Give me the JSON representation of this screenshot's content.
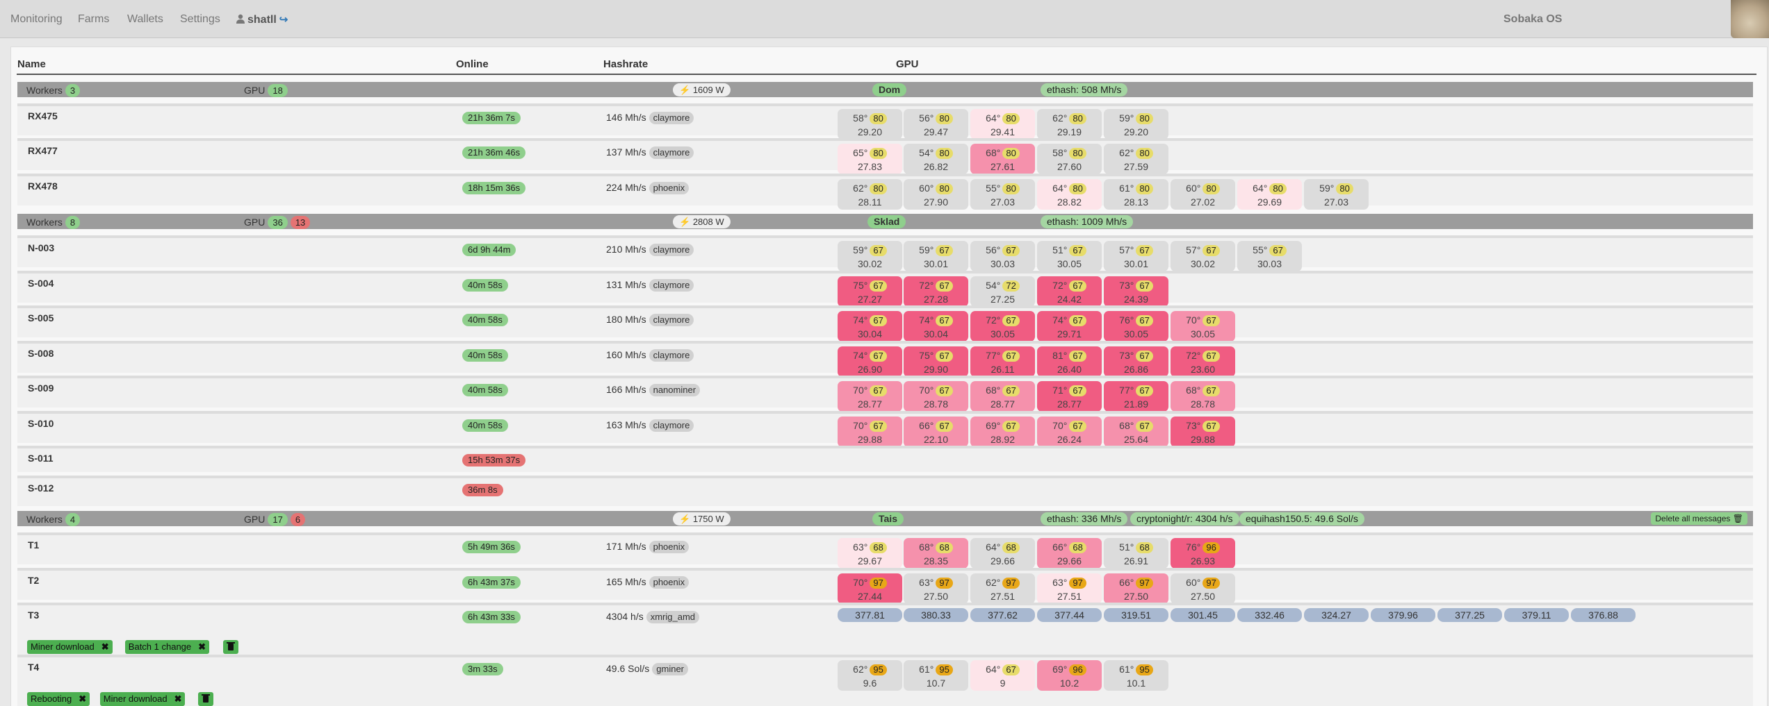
{
  "nav": {
    "items": [
      "Monitoring",
      "Farms",
      "Wallets",
      "Settings"
    ],
    "user": "shatll",
    "brand": "Sobaka OS"
  },
  "headers": {
    "name": "Name",
    "online": "Online",
    "hashrate": "Hashrate",
    "gpu": "GPU"
  },
  "farms": [
    {
      "workers_label": "Workers",
      "workers_count": "3",
      "gpu_label": "GPU",
      "gpu_ok": "18",
      "gpu_bad": "",
      "power": "1609 W",
      "name": "Dom",
      "algos": [
        "ethash: 508 Mh/s"
      ],
      "delete_all": "",
      "workers": [
        {
          "name": "RX475",
          "online": "21h 36m 7s",
          "online_ok": true,
          "hashrate": "146 Mh/s",
          "miner": "claymore",
          "gpus": [
            [
              "58°",
              "80",
              "29.20",
              "normal",
              "yellow"
            ],
            [
              "56°",
              "80",
              "29.47",
              "normal",
              "yellow"
            ],
            [
              "64°",
              "80",
              "29.41",
              "warm",
              "yellow"
            ],
            [
              "62°",
              "80",
              "29.19",
              "normal",
              "yellow"
            ],
            [
              "59°",
              "80",
              "29.20",
              "normal",
              "yellow"
            ]
          ],
          "hr_only": [],
          "messages": []
        },
        {
          "name": "RX477",
          "online": "21h 36m 46s",
          "online_ok": true,
          "hashrate": "137 Mh/s",
          "miner": "claymore",
          "gpus": [
            [
              "65°",
              "80",
              "27.83",
              "warm",
              "yellow"
            ],
            [
              "54°",
              "80",
              "26.82",
              "normal",
              "yellow"
            ],
            [
              "68°",
              "80",
              "27.61",
              "hot",
              "yellow"
            ],
            [
              "58°",
              "80",
              "27.60",
              "normal",
              "yellow"
            ],
            [
              "62°",
              "80",
              "27.59",
              "normal",
              "yellow"
            ]
          ],
          "hr_only": [],
          "messages": []
        },
        {
          "name": "RX478",
          "online": "18h 15m 36s",
          "online_ok": true,
          "hashrate": "224 Mh/s",
          "miner": "phoenix",
          "gpus": [
            [
              "62°",
              "80",
              "28.11",
              "normal",
              "yellow"
            ],
            [
              "60°",
              "80",
              "27.90",
              "normal",
              "yellow"
            ],
            [
              "55°",
              "80",
              "27.03",
              "normal",
              "yellow"
            ],
            [
              "64°",
              "80",
              "28.82",
              "warm",
              "yellow"
            ],
            [
              "61°",
              "80",
              "28.13",
              "normal",
              "yellow"
            ],
            [
              "60°",
              "80",
              "27.02",
              "normal",
              "yellow"
            ],
            [
              "64°",
              "80",
              "29.69",
              "warm",
              "yellow"
            ],
            [
              "59°",
              "80",
              "27.03",
              "normal",
              "yellow"
            ]
          ],
          "hr_only": [],
          "messages": []
        }
      ]
    },
    {
      "workers_label": "Workers",
      "workers_count": "8",
      "gpu_label": "GPU",
      "gpu_ok": "36",
      "gpu_bad": "13",
      "power": "2808 W",
      "name": "Sklad",
      "algos": [
        "ethash: 1009 Mh/s"
      ],
      "delete_all": "",
      "workers": [
        {
          "name": "N-003",
          "online": "6d 9h 44m",
          "online_ok": true,
          "hashrate": "210 Mh/s",
          "miner": "claymore",
          "gpus": [
            [
              "59°",
              "67",
              "30.02",
              "normal",
              "yellow"
            ],
            [
              "59°",
              "67",
              "30.01",
              "normal",
              "yellow"
            ],
            [
              "56°",
              "67",
              "30.03",
              "normal",
              "yellow"
            ],
            [
              "51°",
              "67",
              "30.05",
              "normal",
              "yellow"
            ],
            [
              "57°",
              "67",
              "30.01",
              "normal",
              "yellow"
            ],
            [
              "57°",
              "67",
              "30.02",
              "normal",
              "yellow"
            ],
            [
              "55°",
              "67",
              "30.03",
              "normal",
              "yellow"
            ]
          ],
          "hr_only": [],
          "messages": []
        },
        {
          "name": "S-004",
          "online": "40m 58s",
          "online_ok": true,
          "hashrate": "131 Mh/s",
          "miner": "claymore",
          "gpus": [
            [
              "75°",
              "67",
              "27.27",
              "vhot",
              "yellow"
            ],
            [
              "72°",
              "67",
              "27.28",
              "vhot",
              "yellow"
            ],
            [
              "54°",
              "72",
              "27.25",
              "normal",
              "yellow"
            ],
            [
              "72°",
              "67",
              "24.42",
              "vhot",
              "yellow"
            ],
            [
              "73°",
              "67",
              "24.39",
              "vhot",
              "yellow"
            ]
          ],
          "hr_only": [],
          "messages": []
        },
        {
          "name": "S-005",
          "online": "40m 58s",
          "online_ok": true,
          "hashrate": "180 Mh/s",
          "miner": "claymore",
          "gpus": [
            [
              "74°",
              "67",
              "30.04",
              "vhot",
              "yellow"
            ],
            [
              "74°",
              "67",
              "30.04",
              "vhot",
              "yellow"
            ],
            [
              "72°",
              "67",
              "30.05",
              "vhot",
              "yellow"
            ],
            [
              "74°",
              "67",
              "29.71",
              "vhot",
              "yellow"
            ],
            [
              "76°",
              "67",
              "30.05",
              "vhot",
              "yellow"
            ],
            [
              "70°",
              "67",
              "30.05",
              "hot",
              "yellow"
            ]
          ],
          "hr_only": [],
          "messages": []
        },
        {
          "name": "S-008",
          "online": "40m 58s",
          "online_ok": true,
          "hashrate": "160 Mh/s",
          "miner": "claymore",
          "gpus": [
            [
              "74°",
              "67",
              "26.90",
              "vhot",
              "yellow"
            ],
            [
              "75°",
              "67",
              "29.90",
              "vhot",
              "yellow"
            ],
            [
              "77°",
              "67",
              "26.11",
              "vhot",
              "yellow"
            ],
            [
              "81°",
              "67",
              "26.40",
              "vhot",
              "yellow"
            ],
            [
              "73°",
              "67",
              "26.86",
              "vhot",
              "yellow"
            ],
            [
              "72°",
              "67",
              "23.60",
              "vhot",
              "yellow"
            ]
          ],
          "hr_only": [],
          "messages": []
        },
        {
          "name": "S-009",
          "online": "40m 58s",
          "online_ok": true,
          "hashrate": "166 Mh/s",
          "miner": "nanominer",
          "gpus": [
            [
              "70°",
              "67",
              "28.77",
              "hot",
              "yellow"
            ],
            [
              "70°",
              "67",
              "28.78",
              "hot",
              "yellow"
            ],
            [
              "68°",
              "67",
              "28.77",
              "hot",
              "yellow"
            ],
            [
              "71°",
              "67",
              "28.77",
              "vhot",
              "yellow"
            ],
            [
              "77°",
              "67",
              "21.89",
              "vhot",
              "yellow"
            ],
            [
              "68°",
              "67",
              "28.78",
              "hot",
              "yellow"
            ]
          ],
          "hr_only": [],
          "messages": []
        },
        {
          "name": "S-010",
          "online": "40m 58s",
          "online_ok": true,
          "hashrate": "163 Mh/s",
          "miner": "claymore",
          "gpus": [
            [
              "70°",
              "67",
              "29.88",
              "hot",
              "yellow"
            ],
            [
              "66°",
              "67",
              "22.10",
              "hot",
              "yellow"
            ],
            [
              "69°",
              "67",
              "28.92",
              "hot",
              "yellow"
            ],
            [
              "70°",
              "67",
              "26.24",
              "hot",
              "yellow"
            ],
            [
              "68°",
              "67",
              "25.64",
              "hot",
              "yellow"
            ],
            [
              "73°",
              "67",
              "29.88",
              "vhot",
              "yellow"
            ]
          ],
          "hr_only": [],
          "messages": []
        },
        {
          "name": "S-011",
          "online": "15h 53m 37s",
          "online_ok": false,
          "hashrate": "",
          "miner": "",
          "gpus": [],
          "hr_only": [],
          "messages": []
        },
        {
          "name": "S-012",
          "online": "36m 8s",
          "online_ok": false,
          "hashrate": "",
          "miner": "",
          "gpus": [],
          "hr_only": [],
          "messages": []
        }
      ]
    },
    {
      "workers_label": "Workers",
      "workers_count": "4",
      "gpu_label": "GPU",
      "gpu_ok": "17",
      "gpu_bad": "6",
      "power": "1750 W",
      "name": "Tais",
      "algos": [
        "ethash: 336 Mh/s",
        "cryptonight/r: 4304 h/s",
        "equihash150.5: 49.6 Sol/s"
      ],
      "delete_all": "Delete all messages",
      "workers": [
        {
          "name": "T1",
          "online": "5h 49m 36s",
          "online_ok": true,
          "hashrate": "171 Mh/s",
          "miner": "phoenix",
          "gpus": [
            [
              "63°",
              "68",
              "29.67",
              "warm",
              "yellow"
            ],
            [
              "68°",
              "68",
              "28.35",
              "hot",
              "yellow"
            ],
            [
              "64°",
              "68",
              "29.66",
              "normal",
              "yellow"
            ],
            [
              "66°",
              "68",
              "29.66",
              "hot",
              "yellow"
            ],
            [
              "51°",
              "68",
              "26.91",
              "normal",
              "yellow"
            ],
            [
              "76°",
              "96",
              "26.93",
              "vhot",
              "orange"
            ]
          ],
          "hr_only": [],
          "messages": []
        },
        {
          "name": "T2",
          "online": "6h 43m 37s",
          "online_ok": true,
          "hashrate": "165 Mh/s",
          "miner": "phoenix",
          "gpus": [
            [
              "70°",
              "97",
              "27.44",
              "vhot",
              "orange"
            ],
            [
              "63°",
              "97",
              "27.50",
              "normal",
              "orange"
            ],
            [
              "62°",
              "97",
              "27.51",
              "normal",
              "orange"
            ],
            [
              "63°",
              "97",
              "27.51",
              "warm",
              "orange"
            ],
            [
              "66°",
              "97",
              "27.50",
              "hot",
              "orange"
            ],
            [
              "60°",
              "97",
              "27.50",
              "normal",
              "orange"
            ]
          ],
          "hr_only": [],
          "messages": []
        },
        {
          "name": "T3",
          "online": "6h 43m 33s",
          "online_ok": true,
          "hashrate": "4304 h/s",
          "miner": "xmrig_amd",
          "gpus": [],
          "hr_only": [
            "377.81",
            "380.33",
            "377.62",
            "377.44",
            "319.51",
            "301.45",
            "332.46",
            "324.27",
            "379.96",
            "377.25",
            "379.11",
            "376.88"
          ],
          "messages": [
            "Miner download",
            "Batch 1 change"
          ]
        },
        {
          "name": "T4",
          "online": "3m 33s",
          "online_ok": true,
          "hashrate": "49.6 Sol/s",
          "miner": "gminer",
          "gpus": [
            [
              "62°",
              "95",
              "9.6",
              "normal",
              "orange"
            ],
            [
              "61°",
              "95",
              "10.7",
              "normal",
              "orange"
            ],
            [
              "64°",
              "67",
              "9",
              "warm",
              "yellow"
            ],
            [
              "69°",
              "96",
              "10.2",
              "hot",
              "orange"
            ],
            [
              "61°",
              "95",
              "10.1",
              "normal",
              "orange"
            ]
          ],
          "hr_only": [],
          "messages": [
            "Rebooting",
            "Miner download"
          ]
        }
      ]
    }
  ]
}
